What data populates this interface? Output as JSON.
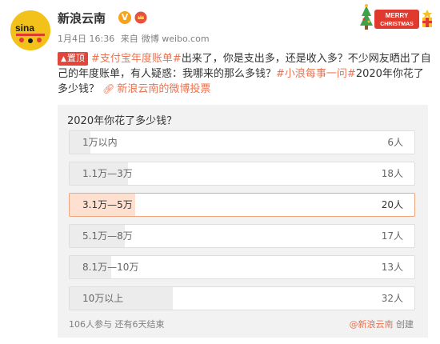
{
  "header": {
    "username": "新浪云南",
    "verified_badge_text": "V",
    "date": "1月4日 16:36",
    "source_prefix": "来自",
    "source": "微博 weibo.com",
    "decoration_text": "MERRY CHRISTMAS"
  },
  "post": {
    "pin_label": "置顶",
    "tag1": "#支付宝年度账单#",
    "text1": "出来了，你是支出多，还是收入多？不少网友晒出了自己的年度账单，有人疑惑：我哪来的那么多钱？",
    "tag2": "#小浪每事一问#",
    "text2": "2020年你花了多少钱？",
    "poll_link": "新浪云南的微博投票"
  },
  "poll": {
    "question": "2020年你花了多少钱？",
    "options": [
      {
        "label": "1万以内",
        "count": "6人",
        "share": 0.06,
        "selected": false
      },
      {
        "label": "1.1万—3万",
        "count": "18人",
        "share": 0.17,
        "selected": false
      },
      {
        "label": "3.1万—5万",
        "count": "20人",
        "share": 0.19,
        "selected": true
      },
      {
        "label": "5.1万—8万",
        "count": "17人",
        "share": 0.16,
        "selected": false
      },
      {
        "label": "8.1万—10万",
        "count": "13人",
        "share": 0.12,
        "selected": false
      },
      {
        "label": "10万以上",
        "count": "32人",
        "share": 0.3,
        "selected": false
      }
    ],
    "participants": "106人参与",
    "remaining": "还有6天结束",
    "creator": "@新浪云南",
    "created_label": "创建"
  },
  "colors": {
    "accent": "#eb7350",
    "pin": "#e2463a",
    "selected_fill": "#fde0cf",
    "selected_border": "#f0a67c"
  }
}
